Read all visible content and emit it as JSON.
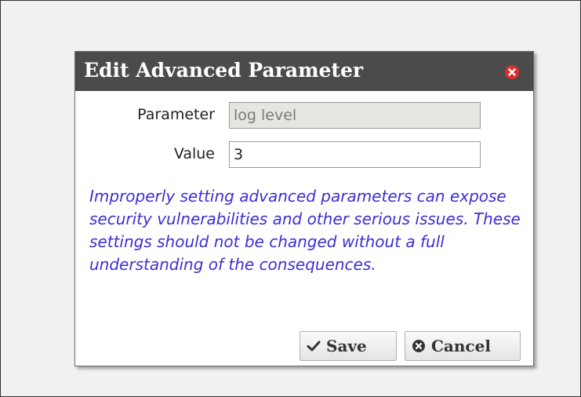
{
  "dialog": {
    "title": "Edit Advanced Parameter",
    "close_icon": "close-icon"
  },
  "form": {
    "parameter_label": "Parameter",
    "parameter_value": "log level",
    "value_label": "Value",
    "value_value": "3"
  },
  "warning_text": "Improperly setting advanced parameters can expose security vulnerabilities and other serious issues. These settings should not be changed without a full understanding of the consequences.",
  "buttons": {
    "save_label": "Save",
    "save_icon": "checkmark-icon",
    "cancel_label": "Cancel",
    "cancel_icon": "cancel-circle-icon"
  },
  "colors": {
    "titlebar": "#4b4b4b",
    "close": "#dc2e2e",
    "warning_text": "#3c2fd3",
    "readonly_field": "#e5e5e1"
  }
}
